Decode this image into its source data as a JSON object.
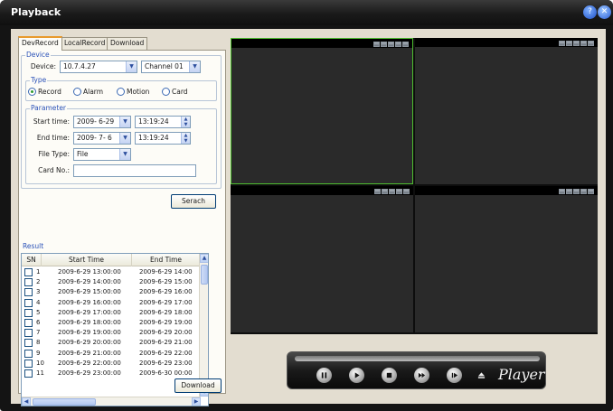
{
  "window": {
    "title": "Playback"
  },
  "tabs": [
    "DevRecord",
    "LocalRecord",
    "Download"
  ],
  "device": {
    "legend": "Device",
    "device_label": "Device:",
    "device_value": "10.7.4.27",
    "channel_value": "Channel 01",
    "type_legend": "Type",
    "types": [
      "Record",
      "Alarm",
      "Motion",
      "Card"
    ],
    "selected_type": "Record",
    "param_legend": "Parameter",
    "start_label": "Start time:",
    "start_date": "2009- 6-29",
    "start_time": "13:19:24",
    "end_label": "End time:",
    "end_date": "2009- 7- 6",
    "end_time": "13:19:24",
    "filetype_label": "File Type:",
    "filetype_value": "File",
    "cardno_label": "Card No.:",
    "cardno_value": "",
    "search_label": "Serach"
  },
  "result": {
    "legend": "Result",
    "columns": [
      "SN",
      "Start Time",
      "End Time"
    ],
    "rows": [
      {
        "sn": "1",
        "start": "2009-6-29 13:00:00",
        "end": "2009-6-29 14:00"
      },
      {
        "sn": "2",
        "start": "2009-6-29 14:00:00",
        "end": "2009-6-29 15:00"
      },
      {
        "sn": "3",
        "start": "2009-6-29 15:00:00",
        "end": "2009-6-29 16:00"
      },
      {
        "sn": "4",
        "start": "2009-6-29 16:00:00",
        "end": "2009-6-29 17:00"
      },
      {
        "sn": "5",
        "start": "2009-6-29 17:00:00",
        "end": "2009-6-29 18:00"
      },
      {
        "sn": "6",
        "start": "2009-6-29 18:00:00",
        "end": "2009-6-29 19:00"
      },
      {
        "sn": "7",
        "start": "2009-6-29 19:00:00",
        "end": "2009-6-29 20:00"
      },
      {
        "sn": "8",
        "start": "2009-6-29 20:00:00",
        "end": "2009-6-29 21:00"
      },
      {
        "sn": "9",
        "start": "2009-6-29 21:00:00",
        "end": "2009-6-29 22:00"
      },
      {
        "sn": "10",
        "start": "2009-6-29 22:00:00",
        "end": "2009-6-29 23:00"
      },
      {
        "sn": "11",
        "start": "2009-6-29 23:00:00",
        "end": "2009-6-30 00:00"
      }
    ],
    "download_label": "Download"
  },
  "video": {
    "pane_tools": [
      "snapshot-icon",
      "record-icon",
      "zoom-icon",
      "audio-icon",
      "close-icon"
    ],
    "active_border_color": "#4fbf30"
  },
  "player": {
    "logo": "Player",
    "buttons": [
      "pause-icon",
      "play-icon",
      "stop-icon",
      "fast-forward-icon",
      "step-forward-icon",
      "eject-icon"
    ]
  }
}
